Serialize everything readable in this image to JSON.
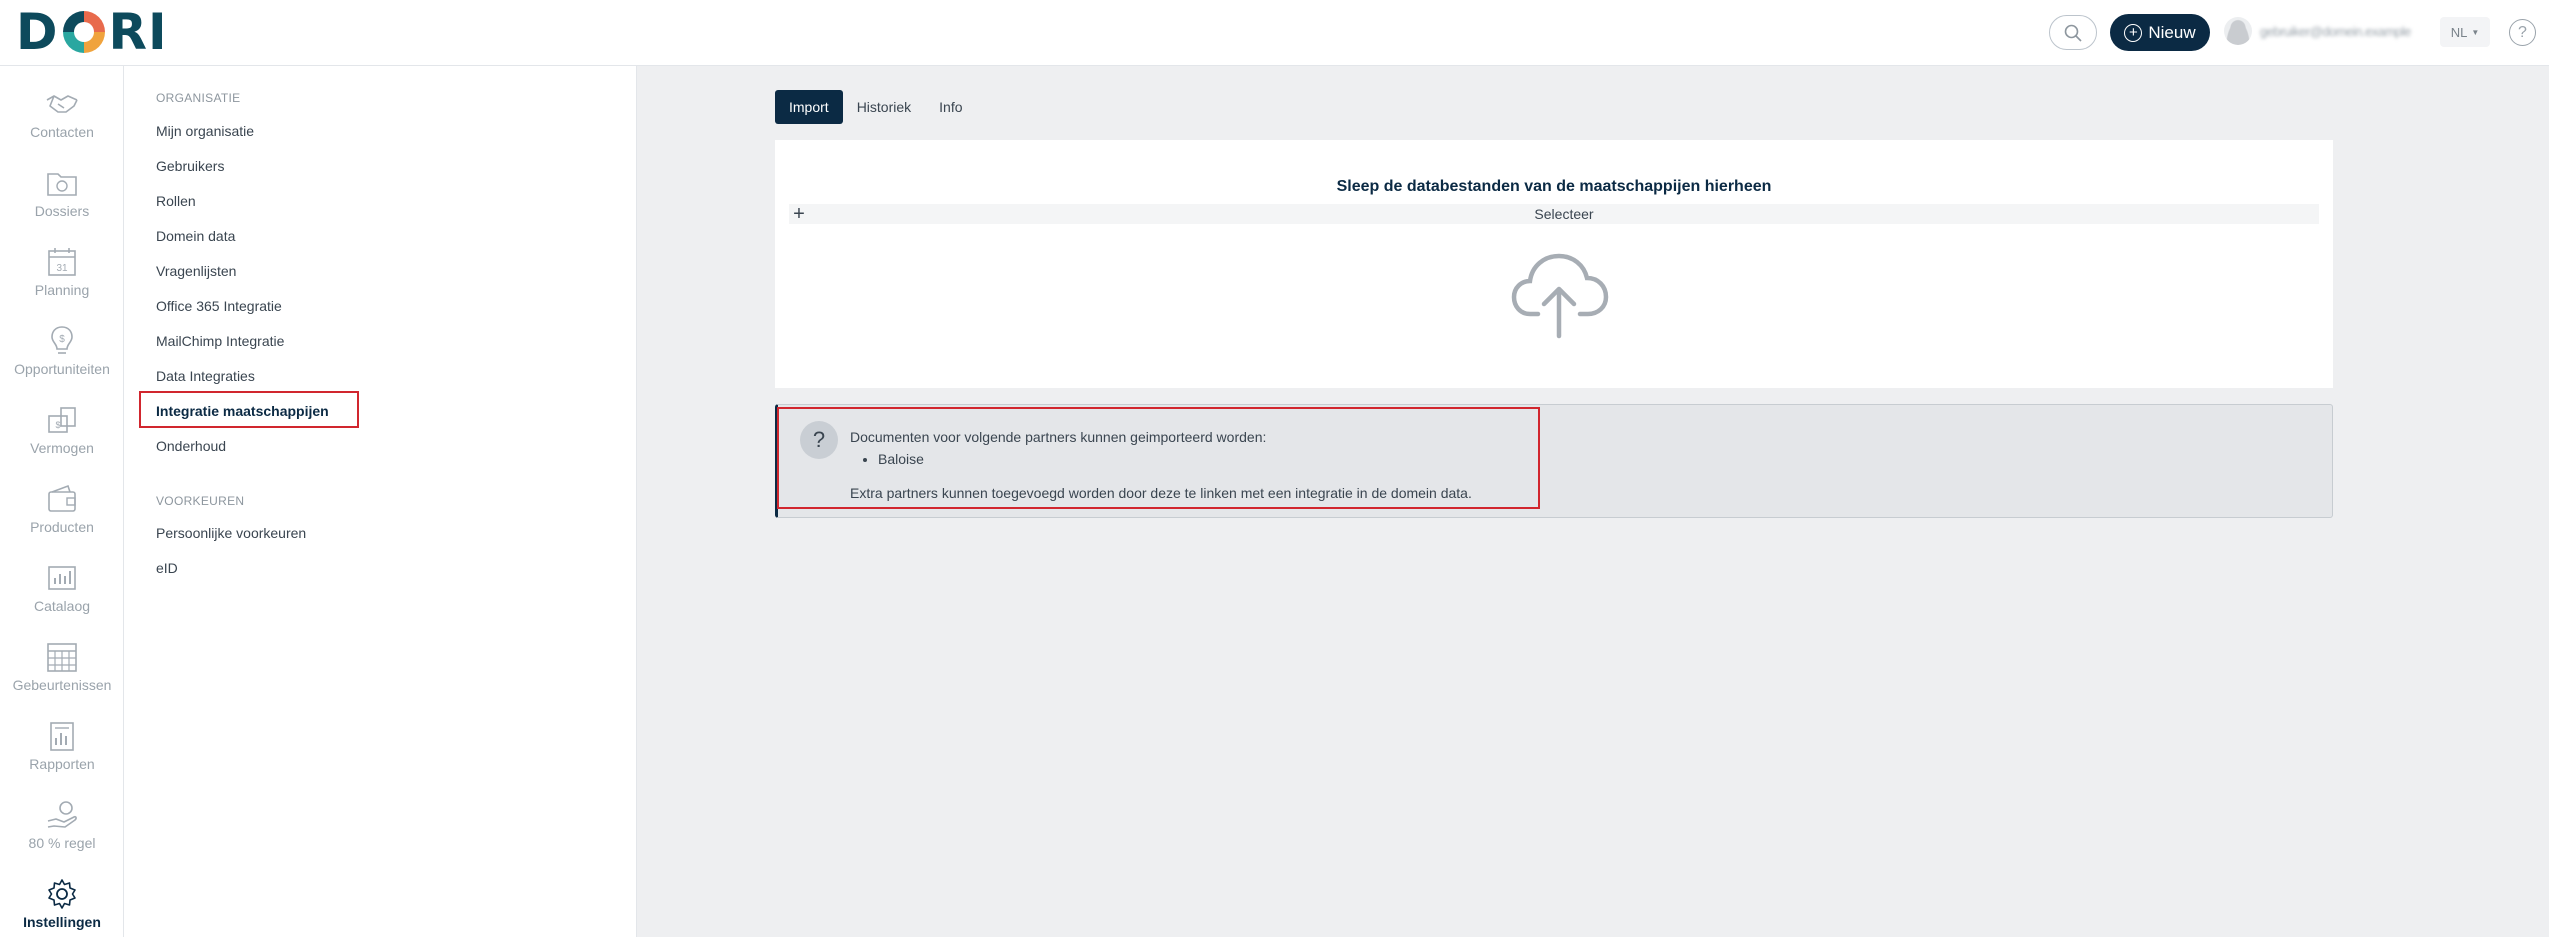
{
  "header": {
    "logo_text_left": "D",
    "logo_text_right": "RI",
    "new_button_label": "Nieuw",
    "user_name": "gebruiker@domein.example",
    "language": "NL"
  },
  "leftnav": {
    "items": [
      {
        "label": "Contacten",
        "icon": "handshake-icon"
      },
      {
        "label": "Dossiers",
        "icon": "folder-icon"
      },
      {
        "label": "Planning",
        "icon": "calendar-icon"
      },
      {
        "label": "Opportuniteiten",
        "icon": "lightbulb-icon"
      },
      {
        "label": "Vermogen",
        "icon": "money-icon"
      },
      {
        "label": "Producten",
        "icon": "wallet-icon"
      },
      {
        "label": "Catalaog",
        "icon": "chart-icon"
      },
      {
        "label": "Gebeurtenissen",
        "icon": "grid-calendar-icon"
      },
      {
        "label": "Rapporten",
        "icon": "report-icon"
      },
      {
        "label": "80 % regel",
        "icon": "hand-coin-icon"
      },
      {
        "label": "Instellingen",
        "icon": "gear-icon"
      }
    ]
  },
  "settings_menu": {
    "organisatie_heading": "ORGANISATIE",
    "organisatie_items": [
      "Mijn organisatie",
      "Gebruikers",
      "Rollen",
      "Domein data",
      "Vragenlijsten",
      "Office 365 Integratie",
      "MailChimp Integratie",
      "Data Integraties",
      "Integratie maatschappijen",
      "Onderhoud"
    ],
    "voorkeuren_heading": "VOORKEUREN",
    "voorkeuren_items": [
      "Persoonlijke voorkeuren",
      "eID"
    ]
  },
  "main": {
    "tabs": [
      "Import",
      "Historiek",
      "Info"
    ],
    "upload_title": "Sleep de databestanden van de maatschappijen hierheen",
    "select_label": "Selecteer",
    "info_intro": "Documenten voor volgende partners kunnen geimporteerd worden:",
    "partners": [
      "Baloise"
    ],
    "info_extra": "Extra partners kunnen toegevoegd worden door deze te linken met een integratie in de domein data."
  },
  "colors": {
    "brand_dark": "#0b2a44",
    "highlight_red": "#d1262e"
  }
}
